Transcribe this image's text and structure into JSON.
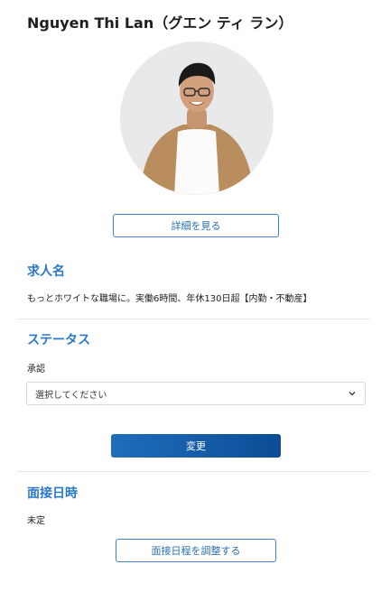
{
  "profile": {
    "name": "Nguyen Thi Lan（グエン ティ ラン）",
    "detail_button": "詳細を見る"
  },
  "job": {
    "heading": "求人名",
    "value": "もっとホワイトな職場に。実働6時間、年休130日超【内勤・不動産】"
  },
  "status": {
    "heading": "ステータス",
    "label": "承認",
    "select_value": "選択してください",
    "submit_button": "変更"
  },
  "interview": {
    "heading": "面接日時",
    "value": "未定",
    "schedule_button": "面接日程を調整する"
  },
  "colors": {
    "accent": "#2a78c8",
    "primary_button": "#0b4d96",
    "outline_button_border": "#3b82c8"
  }
}
